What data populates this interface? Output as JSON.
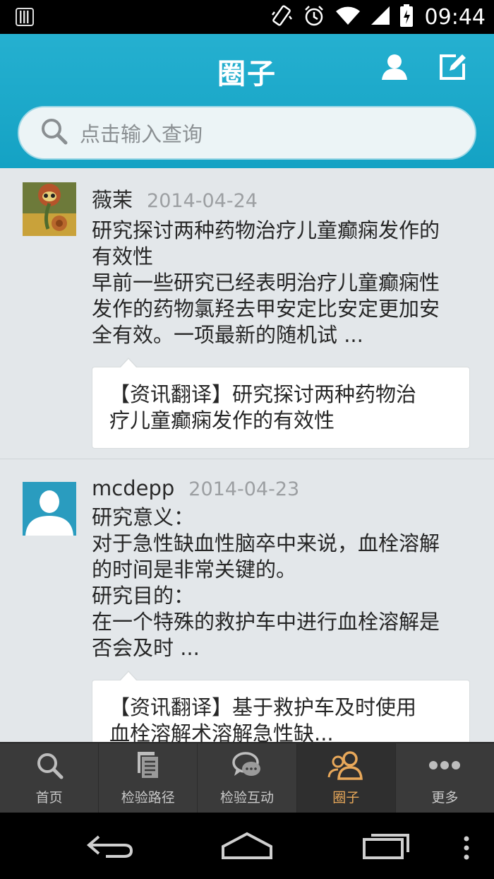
{
  "status_bar": {
    "time": "09:44",
    "icons": [
      "sim-icon",
      "vibrate-icon",
      "alarm-icon",
      "wifi-icon",
      "signal-icon",
      "battery-icon"
    ]
  },
  "header": {
    "title": "圈子",
    "search_placeholder": "点击输入查询",
    "accent_color": "#1ba8c8"
  },
  "posts": [
    {
      "author": "薇茉",
      "date": "2014-04-24",
      "lines": [
        "研究探讨两种药物治疗儿童癫痫发作的",
        "有效性",
        "早前一些研究已经表明治疗儿童癫痫性",
        "发作的药物氯羟去甲安定比安定更加安",
        "全有效。一项最新的随机试 ..."
      ],
      "card_lines": [
        "【资讯翻译】研究探讨两种药物治",
        "疗儿童癫痫发作的有效性"
      ]
    },
    {
      "author": "mcdepp",
      "date": "2014-04-23",
      "lines": [
        "研究意义：",
        "对于急性缺血性脑卒中来说，血栓溶解",
        "的时间是非常关键的。",
        "研究目的：",
        "在一个特殊的救护车中进行血栓溶解是",
        "否会及时 ..."
      ],
      "card_lines": [
        "【资讯翻译】基于救护车及时使用",
        "血栓溶解术溶解急性缺..."
      ]
    }
  ],
  "tabs": [
    {
      "label": "首页",
      "icon": "search-icon"
    },
    {
      "label": "检验路径",
      "icon": "documents-icon"
    },
    {
      "label": "检验互动",
      "icon": "chat-icon"
    },
    {
      "label": "圈子",
      "icon": "people-icon",
      "active": true
    },
    {
      "label": "更多",
      "icon": "more-icon"
    }
  ]
}
